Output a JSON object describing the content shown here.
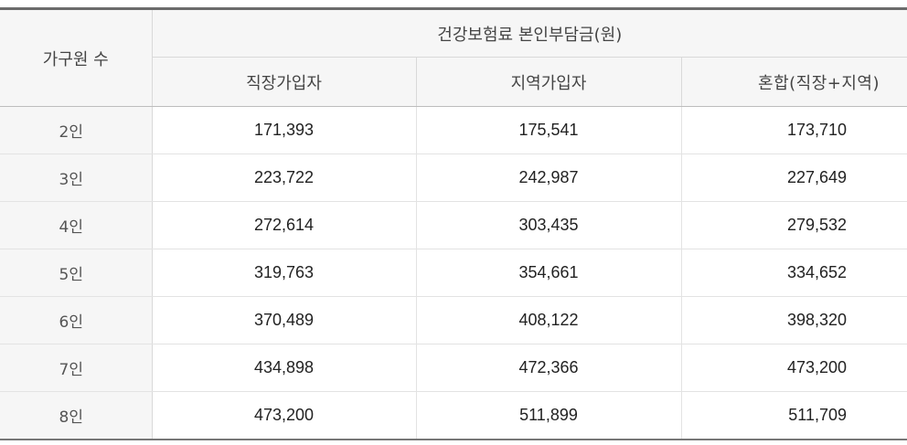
{
  "table": {
    "household_header": "가구원 수",
    "group_header": "건강보험료 본인부담금(원)",
    "sub_headers": [
      "직장가입자",
      "지역가입자",
      "혼합(직장+지역)"
    ],
    "rows": [
      {
        "household": "2인",
        "employee": "171,393",
        "regional": "175,541",
        "mixed": "173,710"
      },
      {
        "household": "3인",
        "employee": "223,722",
        "regional": "242,987",
        "mixed": "227,649"
      },
      {
        "household": "4인",
        "employee": "272,614",
        "regional": "303,435",
        "mixed": "279,532"
      },
      {
        "household": "5인",
        "employee": "319,763",
        "regional": "354,661",
        "mixed": "334,652"
      },
      {
        "household": "6인",
        "employee": "370,489",
        "regional": "408,122",
        "mixed": "398,320"
      },
      {
        "household": "7인",
        "employee": "434,898",
        "regional": "472,366",
        "mixed": "473,200"
      },
      {
        "household": "8인",
        "employee": "473,200",
        "regional": "511,899",
        "mixed": "511,709"
      }
    ]
  }
}
